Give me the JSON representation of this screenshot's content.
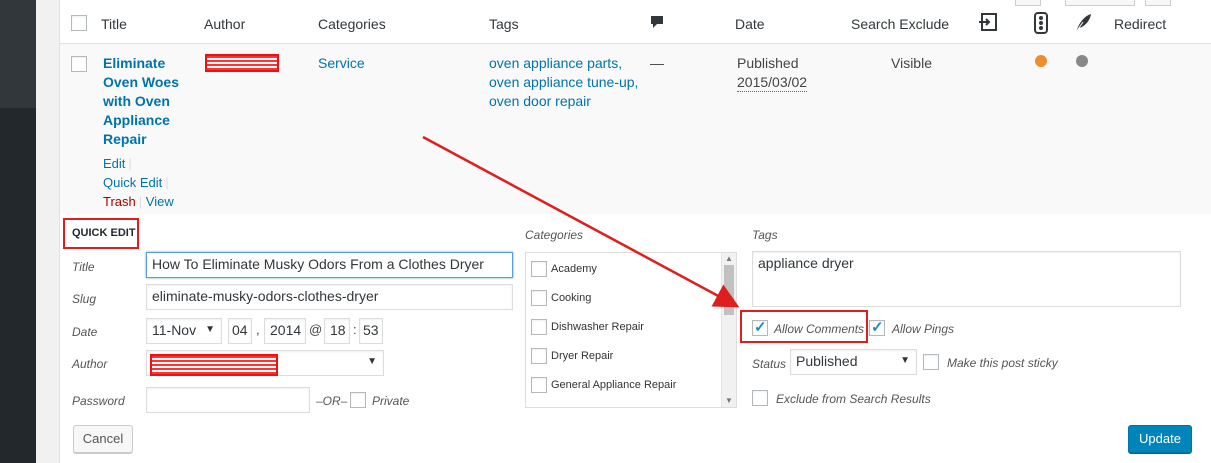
{
  "columns": {
    "title": "Title",
    "author": "Author",
    "categories": "Categories",
    "tags": "Tags",
    "date": "Date",
    "search_exclude": "Search Exclude",
    "redirect": "Redirect"
  },
  "post": {
    "title_lines": [
      "Eliminate",
      "Oven Woes",
      "with Oven",
      "Appliance",
      "Repair"
    ],
    "category": "Service",
    "tags": [
      "oven appliance parts,",
      "oven appliance tune-up,",
      "oven door repair"
    ],
    "comments": "—",
    "status": "Published",
    "date": "2015/03/02",
    "search_exclude": "Visible",
    "dot_colors": {
      "seo": "#ee8d2c",
      "redirect": "#888888"
    },
    "actions": {
      "edit": "Edit",
      "quick_edit": "Quick Edit",
      "trash": "Trash",
      "view": "View"
    }
  },
  "quick_edit": {
    "heading": "QUICK EDIT",
    "labels": {
      "title": "Title",
      "slug": "Slug",
      "date": "Date",
      "author": "Author",
      "password": "Password",
      "or": "–OR–",
      "private": "Private",
      "categories": "Categories",
      "tags": "Tags",
      "status": "Status",
      "sticky": "Make this post sticky",
      "exclude": "Exclude from Search Results"
    },
    "title_value": "How To Eliminate Musky Odors From a Clothes Dryer",
    "slug_value": "eliminate-musky-odors-clothes-dryer",
    "date": {
      "month": "11-Nov",
      "day": "04",
      "year": "2014",
      "hour": "18",
      "minute": "53",
      "comma": ",",
      "at": "@",
      "colon": ":"
    },
    "categories_list": [
      "Academy",
      "Cooking",
      "Dishwasher Repair",
      "Dryer Repair",
      "General Appliance Repair"
    ],
    "tags_value": "appliance dryer",
    "allow_comments": "Allow Comments",
    "allow_pings": "Allow Pings",
    "status_value": "Published",
    "cancel": "Cancel",
    "update": "Update"
  },
  "colors": {
    "accent": "#0073aa",
    "annotation": "#dd1f1f",
    "primary_button": "#0085ba"
  }
}
